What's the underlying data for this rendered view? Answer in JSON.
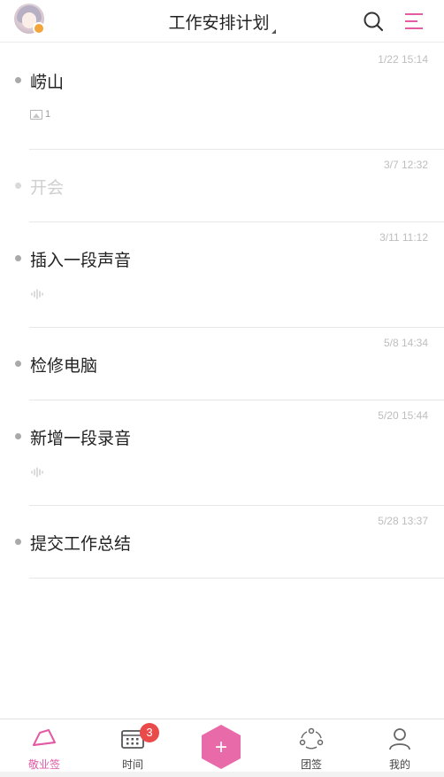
{
  "header": {
    "title": "工作安排计划"
  },
  "notes": [
    {
      "name": "崂山",
      "date": "1/22 15:14",
      "attachment": "image",
      "image_count": "1",
      "done": false
    },
    {
      "name": "开会",
      "date": "3/7 12:32",
      "attachment": "none",
      "done": true
    },
    {
      "name": "插入一段声音",
      "date": "3/11 11:12",
      "attachment": "audio",
      "done": false
    },
    {
      "name": "检修电脑",
      "date": "5/8 14:34",
      "attachment": "none",
      "done": false
    },
    {
      "name": "新增一段录音",
      "date": "5/20 15:44",
      "attachment": "audio",
      "done": false
    },
    {
      "name": "提交工作总结",
      "date": "5/28 13:37",
      "attachment": "none",
      "done": false
    }
  ],
  "tabbar": {
    "tab1": "敬业签",
    "tab2": "时间",
    "tab2_badge": "3",
    "tab4": "团签",
    "tab5": "我的",
    "add_symbol": "+"
  },
  "colors": {
    "accent": "#e35aa5",
    "badge": "#e94a4a"
  }
}
